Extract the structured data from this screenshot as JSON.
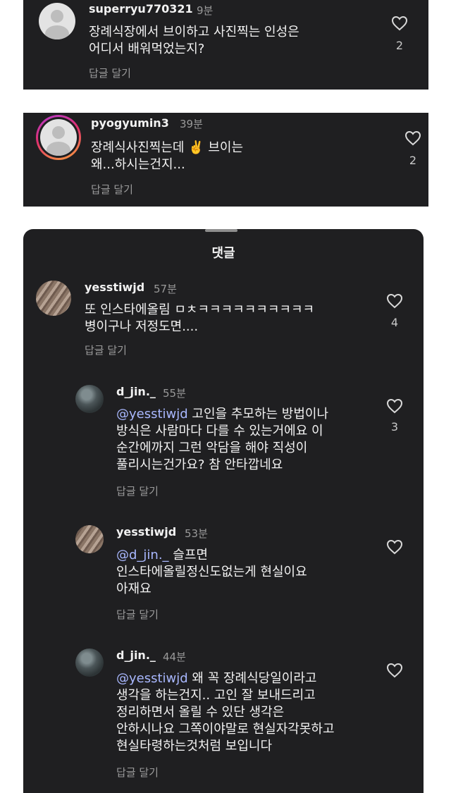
{
  "top_comments": [
    {
      "username": "superryu770321",
      "time": "9분",
      "lines": [
        "장례식장에서 브이하고 사진찍는 인성은",
        "어디서 배워먹었는지?"
      ],
      "likes": "2",
      "reply_label": "답글 달기"
    },
    {
      "username": "pyogyumin3",
      "time": "39분",
      "lines": [
        "장례식사진찍는데 ✌️ 브이는",
        "왜...하시는건지..."
      ],
      "likes": "2",
      "reply_label": "답글 달기"
    }
  ],
  "sheet": {
    "title": "댓글",
    "comments": [
      {
        "username": "yesstiwjd",
        "time": "57분",
        "lines": [
          "또 인스타에올림 ㅁㅊㅋㅋㅋㅋㅋㅋㅋㅋㅋㅋ",
          "병이구나 저정도면...."
        ],
        "likes": "4",
        "reply_label": "답글 달기"
      },
      {
        "username": "d_jin._",
        "time": "55분",
        "mention": "@yesstiwjd",
        "line1_rest": " 고인을 추모하는 방법이나",
        "lines": [
          "방식은 사람마다 다를 수 있는거에요 이",
          "순간에까지 그런 악담을 해야 직성이",
          "풀리시는건가요? 참 안타깝네요"
        ],
        "likes": "3",
        "reply_label": "답글 달기"
      },
      {
        "username": "yesstiwjd",
        "time": "53분",
        "mention": "@d_jin._",
        "line1_rest": "  슬프면",
        "lines": [
          "인스타에올릴정신도없는게 현실이요",
          "아재요"
        ],
        "reply_label": "답글 달기"
      },
      {
        "username": "d_jin._",
        "time": "44분",
        "mention": "@yesstiwjd",
        "line1_rest": " 왜 꼭 장례식당일이라고",
        "lines": [
          "생각을 하는건지.. 고인 잘 보내드리고",
          "정리하면서 올릴 수 있단 생각은",
          "안하시나요 그쪽이야말로 현실자각못하고",
          "현실타령하는것처럼 보입니다"
        ],
        "reply_label": "답글 달기"
      }
    ]
  },
  "icons": {
    "like": "heart-outline-icon",
    "default_avatar": "default-avatar-icon"
  },
  "colors": {
    "panel_bg": "#1f1f21",
    "mention": "#a9b8ff",
    "meta": "#9a9a9a"
  }
}
